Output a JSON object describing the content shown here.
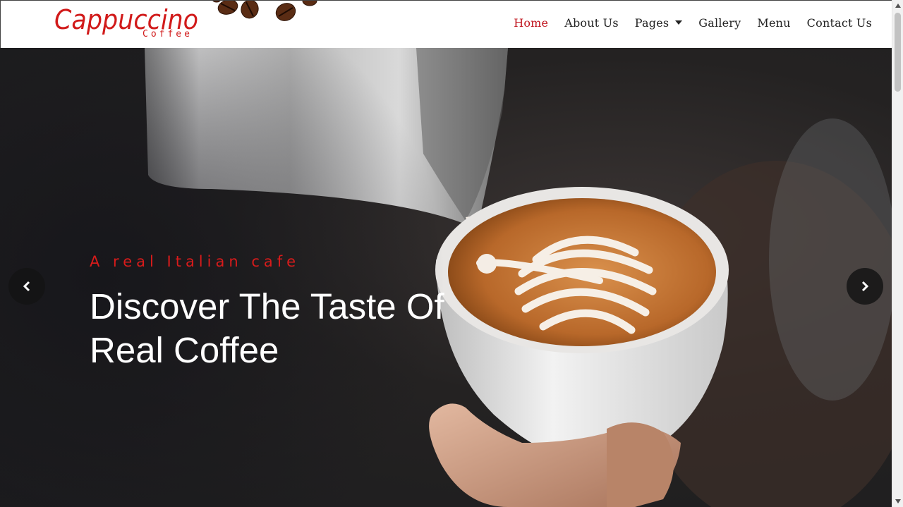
{
  "brand": {
    "name": "Cappuccino",
    "subtitle": "Coffee"
  },
  "nav": {
    "home": "Home",
    "about": "About Us",
    "pages": "Pages",
    "gallery": "Gallery",
    "menu": "Menu",
    "contact": "Contact Us",
    "active": "Home"
  },
  "hero": {
    "tagline": "A real Italian cafe",
    "headline": "Discover The Taste Of Real Coffee",
    "prev_icon": "chevron-left-icon",
    "next_icon": "chevron-right-icon"
  },
  "colors": {
    "accent": "#c0141e",
    "tagline": "#d81b1b",
    "text": "#222222",
    "hero_bg": "#1f1f21"
  }
}
